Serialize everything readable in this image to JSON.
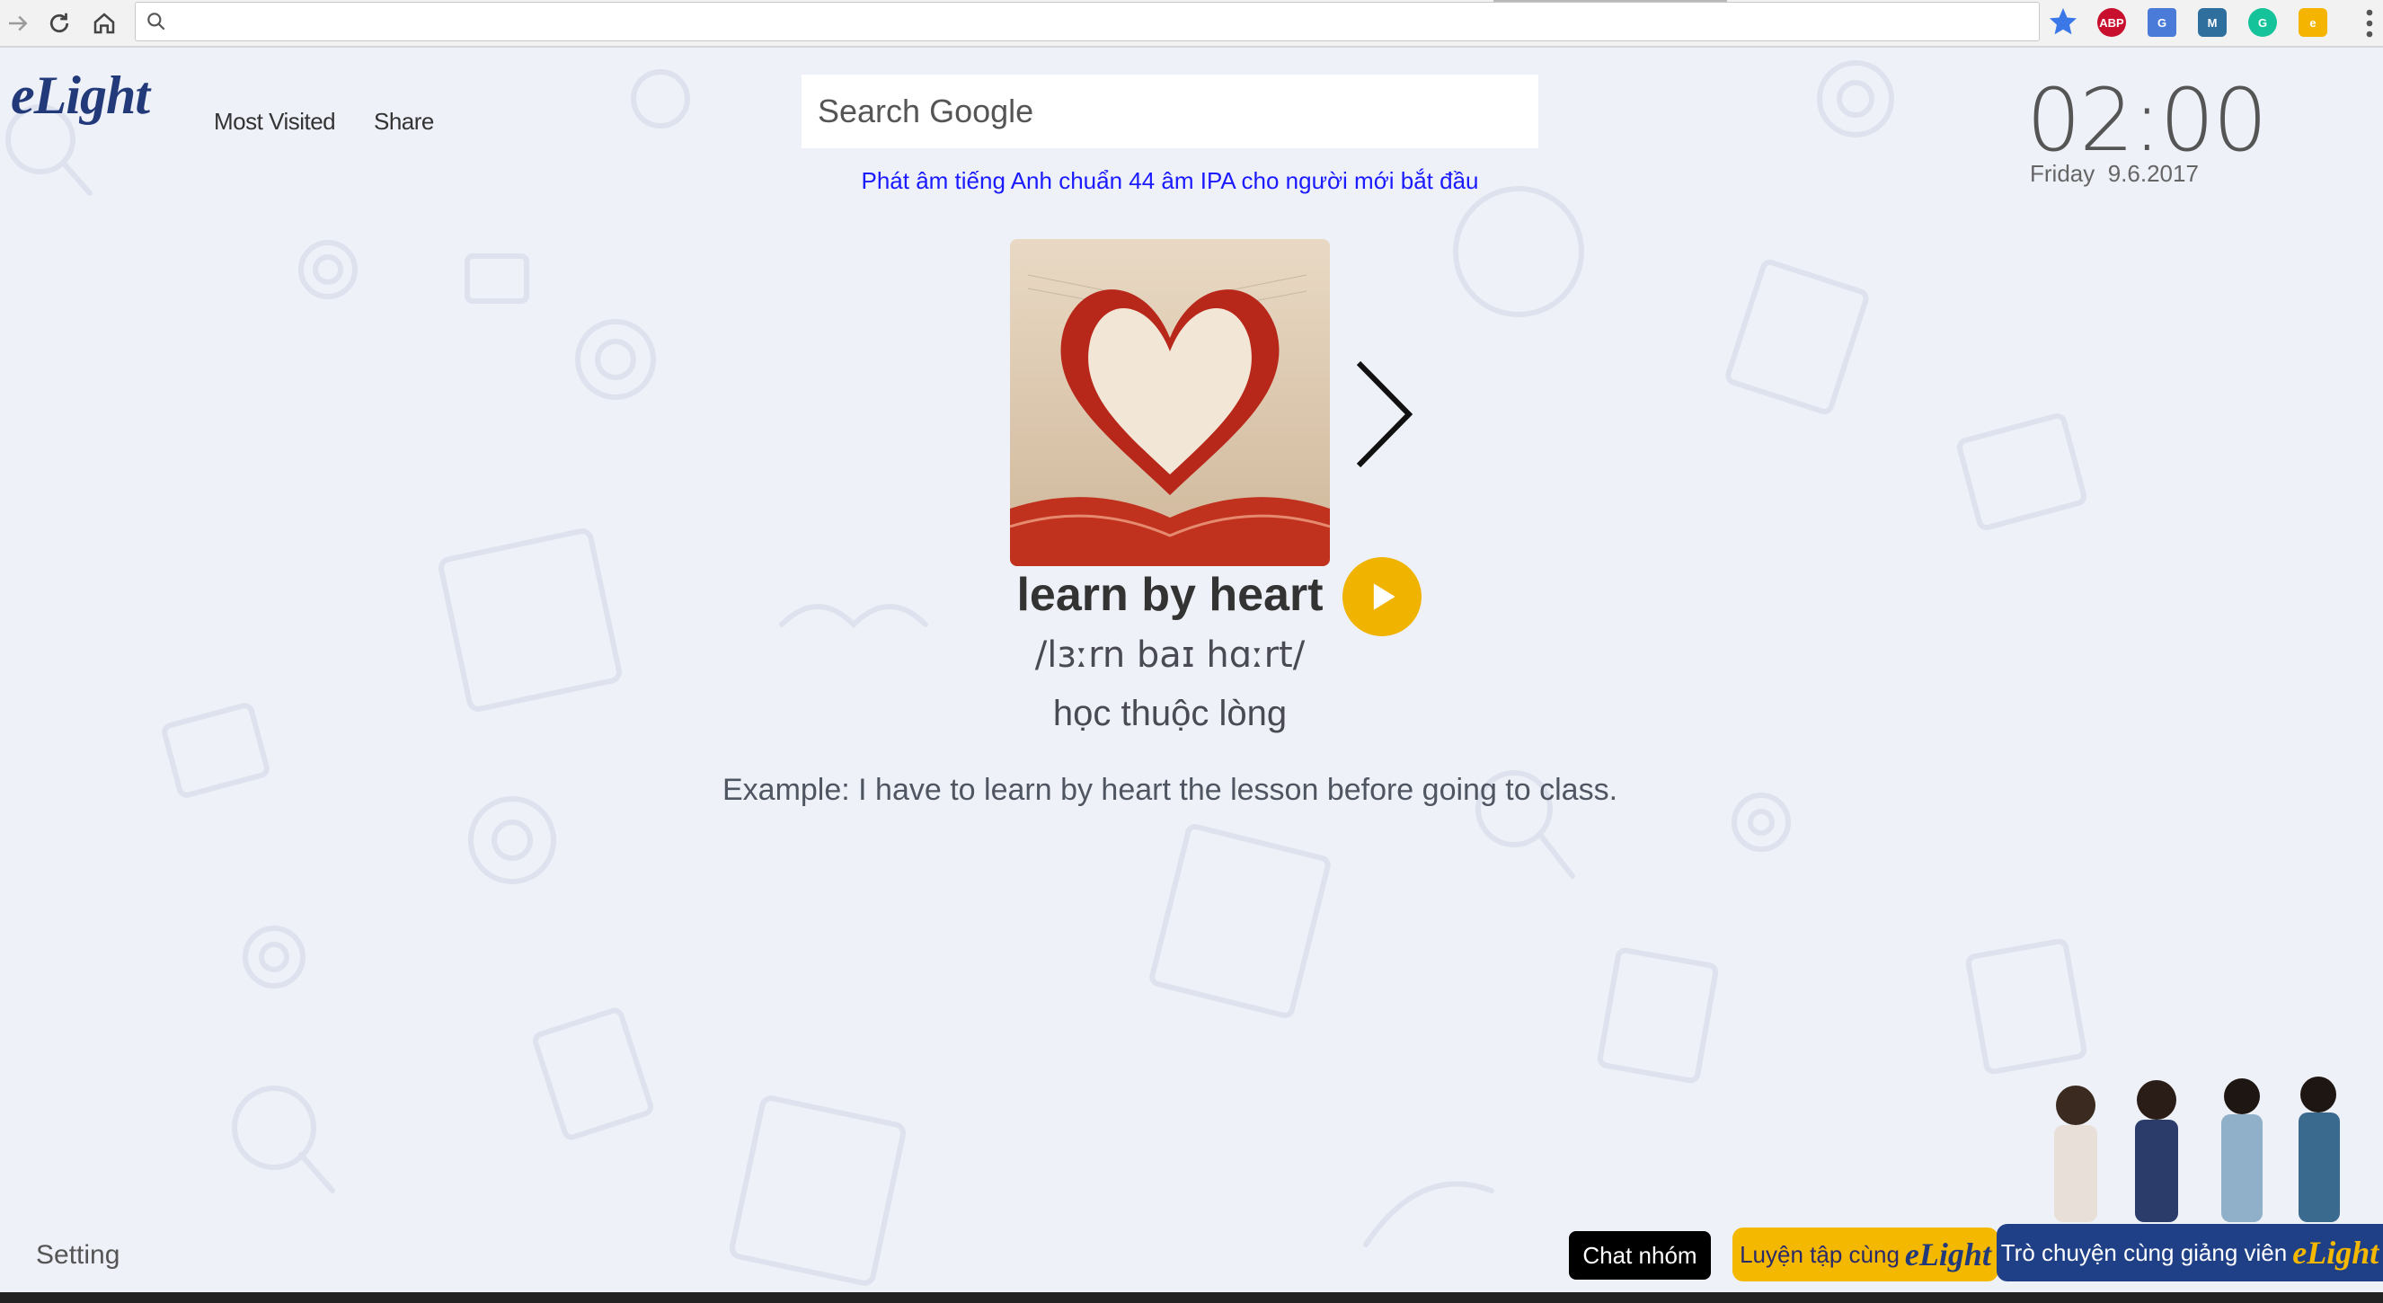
{
  "browser": {
    "url_value": "",
    "extensions": [
      {
        "name": "abp",
        "label": "ABP",
        "color": "#c8102e"
      },
      {
        "name": "google-translate",
        "label": "G",
        "color": "#4a7bd9"
      },
      {
        "name": "extension-m",
        "label": "M",
        "color": "#2e6f9e"
      },
      {
        "name": "grammarly",
        "label": "G",
        "color": "#15c39a"
      },
      {
        "name": "elight",
        "label": "e",
        "color": "#f4b400"
      }
    ]
  },
  "header": {
    "logo": "eLight",
    "nav": {
      "most_visited": "Most Visited",
      "share": "Share"
    },
    "search": {
      "placeholder": "Search Google"
    },
    "promo_link": "Phát âm tiếng Anh chuẩn 44 âm IPA cho người mới bắt đầu",
    "clock": {
      "time": "02:00",
      "day": "Friday",
      "date": "9.6.2017"
    }
  },
  "card": {
    "word": "learn by heart",
    "phonetic": "/lɜːrn baɪ hɑːrt/",
    "meaning": "học thuộc lòng",
    "example": "Example: I have to learn by heart the lesson before going to class."
  },
  "footer": {
    "setting": "Setting",
    "chat_group": "Chat nhóm",
    "practice_label": "Luyện tập cùng",
    "teacher_label": "Trò chuyện cùng giảng viên",
    "brand": "eLight"
  },
  "colors": {
    "accent_yellow": "#f0b300",
    "brand_blue": "#1f3f86",
    "link_blue": "#1a1aff",
    "background": "#eef1f8"
  }
}
